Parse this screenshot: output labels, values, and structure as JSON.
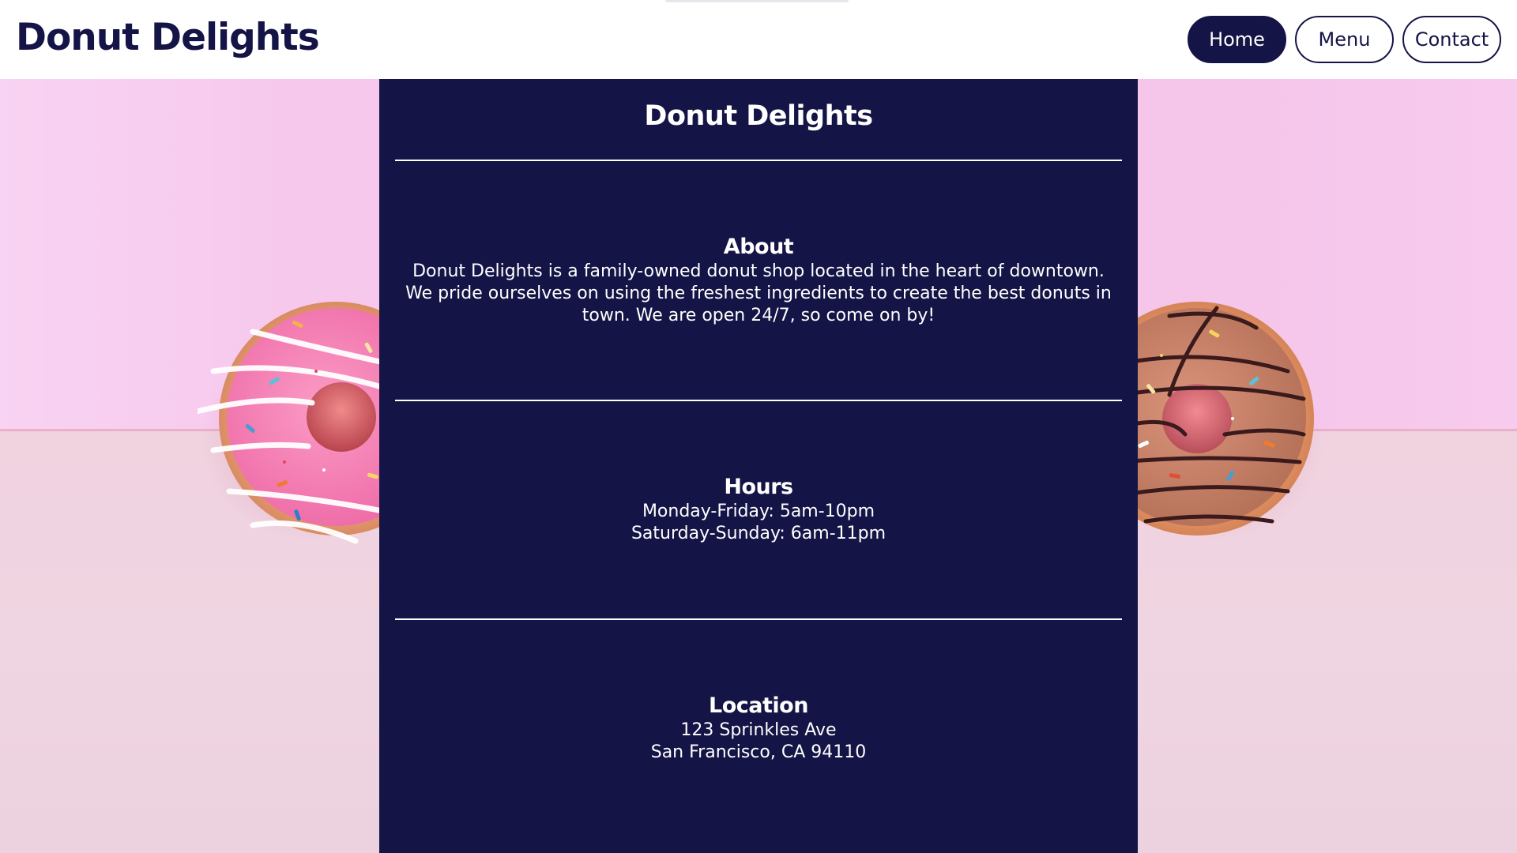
{
  "header": {
    "brand": "Donut Delights",
    "nav": [
      {
        "label": "Home",
        "active": true
      },
      {
        "label": "Menu",
        "active": false
      },
      {
        "label": "Contact",
        "active": false
      }
    ]
  },
  "main": {
    "title": "Donut Delights",
    "about": {
      "heading": "About",
      "text": "Donut Delights is a family-owned donut shop located in the heart of downtown. We pride ourselves on using the freshest ingredients to create the best donuts in town. We are open 24/7, so come on by!"
    },
    "hours": {
      "heading": "Hours",
      "weekdays": "Monday-Friday: 5am-10pm",
      "weekend": "Saturday-Sunday: 6am-11pm"
    },
    "location": {
      "heading": "Location",
      "street": "123 Sprinkles Ave",
      "city": "San Francisco, CA 94110"
    }
  },
  "colors": {
    "navy": "#141446",
    "white": "#ffffff",
    "wall_pink": "#f6c8ec",
    "table_pink": "#efd3e0"
  },
  "icons": {
    "background": "donut-photo"
  }
}
